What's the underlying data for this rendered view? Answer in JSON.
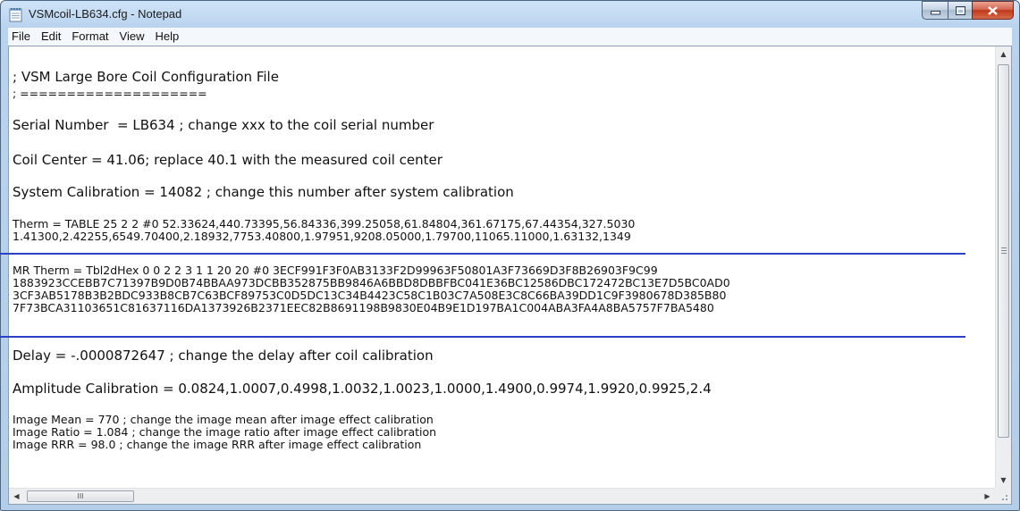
{
  "window": {
    "title": "VSMcoil-LB634.cfg - Notepad",
    "colors": {
      "frame": "#b9d3ee",
      "close_button": "#c0391b",
      "annotation": "#2b3fc7"
    }
  },
  "menu": {
    "file": "File",
    "edit": "Edit",
    "format": "Format",
    "view": "View",
    "help": "Help"
  },
  "document": {
    "header_title": "; VSM Large Bore Coil Configuration File",
    "header_rule": "; ====================",
    "serial_number": "Serial Number  = LB634 ; change xxx to the coil serial number",
    "coil_center": "Coil Center = 41.06; replace 40.1 with the measured coil center",
    "system_calibration": "System Calibration = 14082 ; change this number after system calibration",
    "therm_line1": "Therm = TABLE 25 2 2 #0 52.33624,440.73395,56.84336,399.25058,61.84804,361.67175,67.44354,327.5030",
    "therm_line2": "1.41300,2.42255,6549.70400,2.18932,7753.40800,1.97951,9208.05000,1.79700,11065.11000,1.63132,1349",
    "mr_therm_line1": "MR Therm = Tbl2dHex 0 0 2 2 3 1 1 20 20 #0 3ECF991F3F0AB3133F2D99963F50801A3F73669D3F8B26903F9C99",
    "mr_therm_line2": "1883923CCEBB7C71397B9D0B74BBAA973DCBB352875BB9846A6BBD8DBBFBC041E36BC12586DBC172472BC13E7D5BC0AD0",
    "mr_therm_line3": "3CF3AB5178B3B2BDC933B8CB7C63BCF89753C0D5DC13C34B4423C58C1B03C7A508E3C8C66BA39DD1C9F3980678D385B80",
    "mr_therm_line4": "7F73BCA31103651C81637116DA1373926B2371EEC82B8691198B9830E04B9E1D197BA1C004ABA3FA4A8BA5757F7BA5480",
    "delay": "Delay = -.0000872647 ; change the delay after coil calibration",
    "amplitude_calibration": "Amplitude Calibration = 0.0824,1.0007,0.4998,1.0032,1.0023,1.0000,1.4900,0.9974,1.9920,0.9925,2.4",
    "image_mean": "Image Mean = 770 ; change the image mean after image effect calibration",
    "image_ratio": "Image Ratio = 1.084 ; change the image ratio after image effect calibration",
    "image_rrr": "Image RRR = 98.0 ; change the image RRR after image effect calibration"
  },
  "scrollbar": {
    "hthumb_grip": "III"
  },
  "icons": {
    "app": "notepad-icon",
    "minimize": "minimize-icon",
    "maximize": "maximize-icon",
    "close": "close-icon"
  }
}
